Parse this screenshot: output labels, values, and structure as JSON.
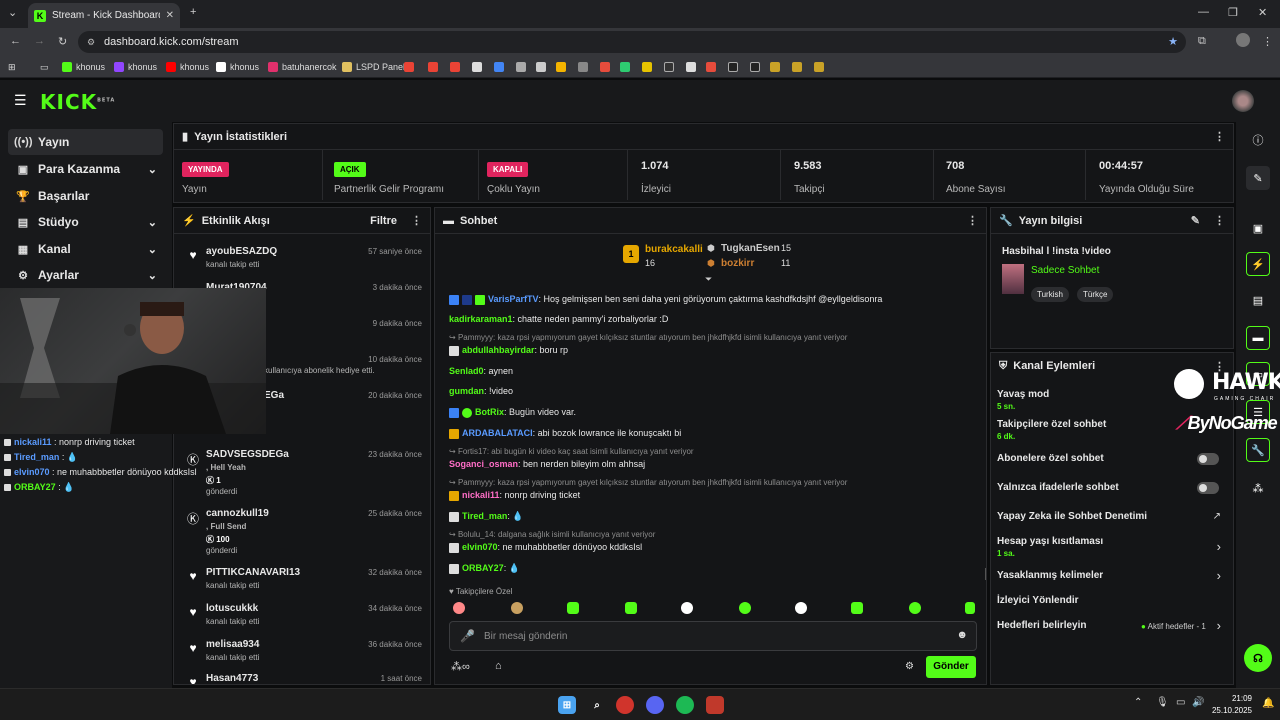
{
  "browser": {
    "tab_title": "Stream - Kick Dashboard",
    "url": "dashboard.kick.com/stream",
    "bookmarks": [
      "khonus",
      "khonus",
      "khonus",
      "khonus",
      "batuhanercok",
      "LSPD Panel"
    ]
  },
  "kick": {
    "logo": "KICK",
    "logo_sup": "BETA"
  },
  "sidebar": {
    "items": [
      {
        "label": "Yayın",
        "icon": "broadcast-icon"
      },
      {
        "label": "Para Kazanma",
        "icon": "money-icon"
      },
      {
        "label": "Başarılar",
        "icon": "trophy-icon"
      },
      {
        "label": "Stüdyo",
        "icon": "studio-icon"
      },
      {
        "label": "Kanal",
        "icon": "channel-icon"
      },
      {
        "label": "Ayarlar",
        "icon": "gear-icon"
      }
    ]
  },
  "stats": {
    "title": "Yayın İstatistikleri",
    "cells": [
      {
        "badge": "YAYINDA",
        "label": "Yayın"
      },
      {
        "badge": "AÇIK",
        "label": "Partnerlik Gelir Programı"
      },
      {
        "badge": "KAPALI",
        "label": "Çoklu Yayın"
      },
      {
        "value": "1.074",
        "label": "İzleyici"
      },
      {
        "value": "9.583",
        "label": "Takipçi"
      },
      {
        "value": "708",
        "label": "Abone Sayısı"
      },
      {
        "value": "00:44:57",
        "label": "Yayında Olduğu Süre"
      }
    ]
  },
  "feed": {
    "title": "Etkinlik Akışı",
    "filter": "Filtre",
    "items": [
      {
        "name": "ayoubESAZDQ",
        "sub": "kanalı takip etti",
        "time": "57 saniye önce"
      },
      {
        "name": "Murat190704",
        "sub": "",
        "time": "3 dakika önce"
      },
      {
        "name": "",
        "sub": "",
        "time": "9 dakika önce"
      },
      {
        "name": "",
        "sub": "kullanıcıya abonelik hediye etti.",
        "time": "10 dakika önce"
      },
      {
        "name": "EGa",
        "sub": "",
        "time": "20 dakika önce"
      },
      {
        "name": "SADVSEGSDEGa",
        "sub": ", Hell Yeah",
        "amount": "1",
        "sub2": "gönderdi",
        "time": "23 dakika önce"
      },
      {
        "name": "cannozkull19",
        "sub": ", Full Send",
        "amount": "100",
        "sub2": "gönderdi",
        "time": "25 dakika önce"
      },
      {
        "name": "PITTIKCANAVARI13",
        "sub": "kanalı takip etti",
        "time": "32 dakika önce"
      },
      {
        "name": "lotuscukkk",
        "sub": "kanalı takip etti",
        "time": "34 dakika önce"
      },
      {
        "name": "melisaa934",
        "sub": "kanalı takip etti",
        "time": "36 dakika önce"
      },
      {
        "name": "Hasan4773",
        "sub": "",
        "time": "1 saat önce"
      }
    ]
  },
  "chat": {
    "title": "Sohbet",
    "leaders": [
      {
        "name": "burakcakalli",
        "count": "16"
      },
      {
        "name": "TugkanEsen",
        "count": "15"
      },
      {
        "name": "bozkirr",
        "count": "11"
      }
    ],
    "messages": [
      {
        "user": "VarisParfTV",
        "text": ": Hoş gelmişsen ben seni daha yeni görüyorum çaktırma kashdfkdsjhf @eyllgeldisonra",
        "color": "#5a9bff"
      },
      {
        "user": "kadirkaraman1",
        "text": ": chatte neden pammy'i zorbaliyorlar :D",
        "color": "#53fc18"
      },
      {
        "reply": "Pammyyy: kaza rpsi yapmıyorum gayet kılçıksız stuntlar atıyorum ben jhkdfhjkfd isimli kullanıcıya yanıt veriyor"
      },
      {
        "user": "abdullahbayirdar",
        "text": ": boru rp",
        "color": "#53fc18"
      },
      {
        "user": "Senlad0",
        "text": ": aynen",
        "color": "#53fc18"
      },
      {
        "user": "gumdan",
        "text": ": !video",
        "color": "#53fc18"
      },
      {
        "user": "BotRix",
        "text": ": Bugün video var.",
        "color": "#53fc18"
      },
      {
        "user": "ARDABALATACI",
        "text": ": abi bozok lowrance ile konuşcaktı bi",
        "color": "#5a9bff"
      },
      {
        "reply": "Fortis17: abi bugün ki video kaç saat isimli kullanıcıya yanıt veriyor"
      },
      {
        "user": "Soganci_osman",
        "text": ": ben nerden bileyim olm ahhsaj",
        "color": "#ff6ec7"
      },
      {
        "reply": "Pammyyy: kaza rpsi yapmıyorum gayet kılçıksız stuntlar atıyorum ben jhkdfhjkfd isimli kullanıcıya yanıt veriyor"
      },
      {
        "user": "nickali11",
        "text": ": nonrp driving ticket",
        "color": "#ff6ec7"
      },
      {
        "user": "Tired_man",
        "text": ": ",
        "color": "#53fc18"
      },
      {
        "reply": "Bolulu_14: dalgana sağlık isimli kullanıcıya yanıt veriyor"
      },
      {
        "user": "elvin070",
        "text": ": ne muhabbbetler dönüyoo kddksIsl",
        "color": "#53fc18"
      },
      {
        "user": "ORBAY27",
        "text": ": ",
        "color": "#53fc18"
      }
    ],
    "followers_only": "Takipçilere Özel",
    "placeholder": "Bir mesaj gönderin",
    "send": "Gönder"
  },
  "info": {
    "title": "Yayın bilgisi",
    "stream_title": "Hasbihal l !insta !video",
    "category": "Sadece Sohbet",
    "tags": [
      "Turkish",
      "Türkçe"
    ]
  },
  "actions": {
    "title": "Kanal Eylemleri",
    "slow": {
      "label": "Yavaş mod",
      "value": "5 sn."
    },
    "followers": {
      "label": "Takipçilere özel sohbet",
      "value": "6 dk."
    },
    "subs": {
      "label": "Abonelere özel sohbet"
    },
    "emotes": {
      "label": "Yalnızca ifadelerle sohbet"
    },
    "ai": {
      "label": "Yapay Zeka ile Sohbet Denetimi"
    },
    "age": {
      "label": "Hesap yaşı kısıtlaması",
      "value": "1 sa."
    },
    "banned": {
      "label": "Yasaklanmış kelimeler"
    },
    "redirect": {
      "label": "İzleyici Yönlendir"
    },
    "goals": {
      "label": "Hedefleri belirleyin",
      "status": "Aktif hedefler - 1"
    }
  },
  "overlay": {
    "chat": [
      {
        "user": "nickali11",
        "text": " : nonrp driving ticket",
        "color": "#5a9bff"
      },
      {
        "user": "Tired_man",
        "text": " : ",
        "color": "#5a9bff"
      },
      {
        "user": "elvin070",
        "text": " : ne muhabbbetler dönüyoo kddksIsl",
        "color": "#5a9bff"
      },
      {
        "user": "ORBAY27",
        "text": " : ",
        "color": "#53fc18"
      }
    ],
    "hawk": "HAWK",
    "hawk_sub": "GAMING CHAIR",
    "bynogame": "ByNoGame"
  },
  "taskbar": {
    "time": "21:09",
    "date": "25.10.2025"
  },
  "colors": {
    "kick_green": "#53fc18",
    "live_red": "#e0245e",
    "panel": "#141517"
  }
}
